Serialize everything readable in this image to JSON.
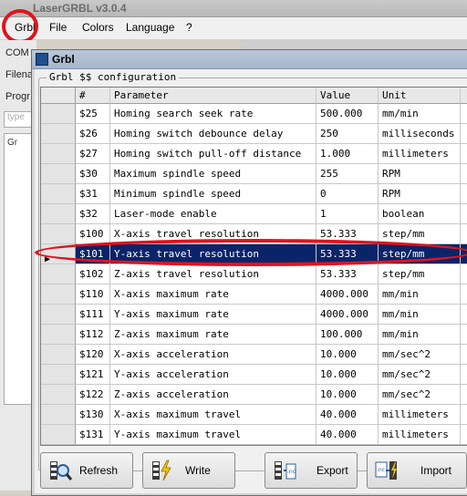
{
  "window": {
    "title": "LaserGRBL v3.0.4"
  },
  "menu": {
    "items": [
      "Grbl",
      "File",
      "Colors",
      "Language",
      "?"
    ]
  },
  "left_panel": {
    "labels": [
      "COM",
      "Filena",
      "Progr"
    ],
    "search_placeholder": "type",
    "tree_node": "Gr"
  },
  "dialog": {
    "title": "Grbl",
    "group_title": "Grbl $$ configuration",
    "columns": [
      "#",
      "Parameter",
      "Value",
      "Unit"
    ],
    "rows": [
      {
        "id": "$25",
        "param": "Homing search seek rate",
        "value": "500.000",
        "unit": "mm/min"
      },
      {
        "id": "$26",
        "param": "Homing switch debounce delay",
        "value": "250",
        "unit": "milliseconds"
      },
      {
        "id": "$27",
        "param": "Homing switch pull-off distance",
        "value": "1.000",
        "unit": "millimeters"
      },
      {
        "id": "$30",
        "param": "Maximum spindle speed",
        "value": "255",
        "unit": "RPM"
      },
      {
        "id": "$31",
        "param": "Minimum spindle speed",
        "value": "0",
        "unit": "RPM"
      },
      {
        "id": "$32",
        "param": "Laser-mode enable",
        "value": "1",
        "unit": "boolean"
      },
      {
        "id": "$100",
        "param": "X-axis travel resolution",
        "value": "53.333",
        "unit": "step/mm"
      },
      {
        "id": "$101",
        "param": "Y-axis travel resolution",
        "value": "53.333",
        "unit": "step/mm",
        "selected": true
      },
      {
        "id": "$102",
        "param": "Z-axis travel resolution",
        "value": "53.333",
        "unit": "step/mm"
      },
      {
        "id": "$110",
        "param": "X-axis maximum rate",
        "value": "4000.000",
        "unit": "mm/min"
      },
      {
        "id": "$111",
        "param": "Y-axis maximum rate",
        "value": "4000.000",
        "unit": "mm/min"
      },
      {
        "id": "$112",
        "param": "Z-axis maximum rate",
        "value": "100.000",
        "unit": "mm/min"
      },
      {
        "id": "$120",
        "param": "X-axis acceleration",
        "value": "10.000",
        "unit": "mm/sec^2"
      },
      {
        "id": "$121",
        "param": "Y-axis acceleration",
        "value": "10.000",
        "unit": "mm/sec^2"
      },
      {
        "id": "$122",
        "param": "Z-axis acceleration",
        "value": "10.000",
        "unit": "mm/sec^2"
      },
      {
        "id": "$130",
        "param": "X-axis maximum travel",
        "value": "40.000",
        "unit": "millimeters"
      },
      {
        "id": "$131",
        "param": "Y-axis maximum travel",
        "value": "40.000",
        "unit": "millimeters"
      }
    ],
    "buttons": {
      "refresh": "Refresh",
      "write": "Write",
      "export": "Export",
      "import": "Import"
    }
  },
  "colors": {
    "selection": "#0a246a",
    "highlight_annotation": "#e0131d"
  }
}
